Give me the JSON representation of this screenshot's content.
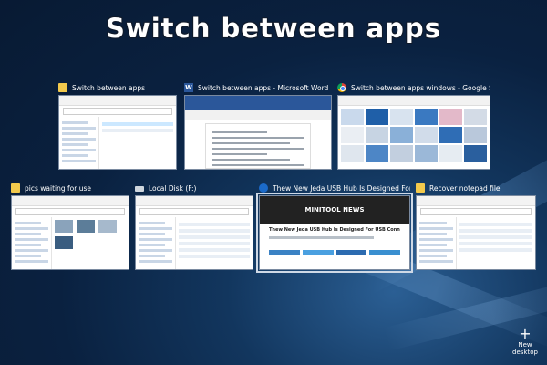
{
  "headline": "Switch between apps",
  "windows_row1": [
    {
      "title": "Switch between apps",
      "icon": "folder-icon"
    },
    {
      "title": "Switch between apps - Microsoft Word",
      "icon": "word-icon"
    },
    {
      "title": "Switch between apps windows - Google Search - Go...",
      "icon": "chrome-icon"
    }
  ],
  "windows_row2": [
    {
      "title": "pics waiting for use",
      "icon": "folder-icon"
    },
    {
      "title": "Local Disk (F:)",
      "icon": "drive-icon"
    },
    {
      "title": "Thew New Jeda USB Hub Is Designed For USB Conne...",
      "icon": "edge-icon"
    },
    {
      "title": "Recover notepad file",
      "icon": "folder-icon"
    }
  ],
  "news_brand": "MINITOOL NEWS",
  "news_headline": "Thew New Jeda USB Hub Is Designed For USB Connectivity",
  "new_desktop": {
    "plus": "+",
    "label": "New desktop"
  }
}
